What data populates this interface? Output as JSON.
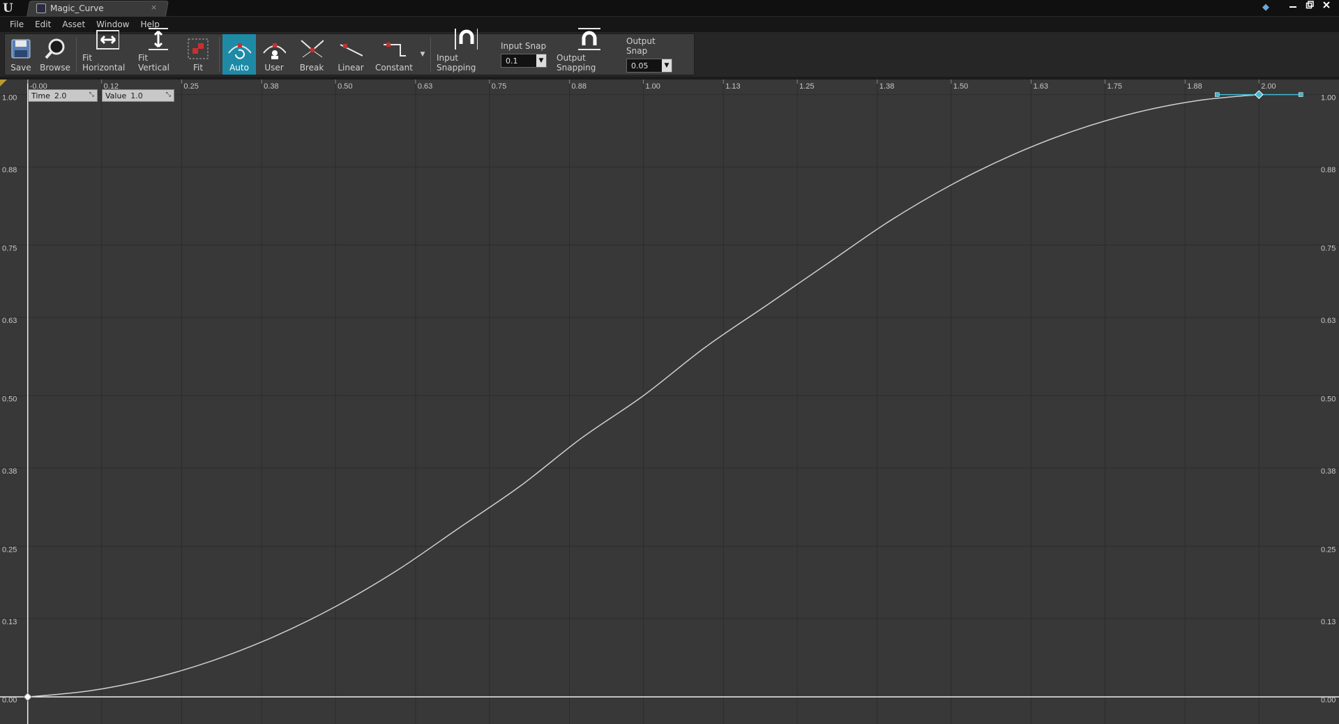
{
  "window": {
    "tab_title": "Magic_Curve",
    "tab_close_glyph": "×",
    "app_icon": "unreal-engine-logo",
    "logo_text": "U",
    "controls": [
      "minimize-icon",
      "restore-icon",
      "close-icon"
    ]
  },
  "menu": {
    "items": [
      "File",
      "Edit",
      "Asset",
      "Window",
      "Help"
    ]
  },
  "toolbar": {
    "save_label": "Save",
    "browse_label": "Browse",
    "fit_horizontal_label": "Fit Horizontal",
    "fit_vertical_label": "Fit Vertical",
    "fit_label": "Fit",
    "auto_label": "Auto",
    "user_label": "User",
    "break_label": "Break",
    "linear_label": "Linear",
    "constant_label": "Constant",
    "input_snapping_label": "Input Snapping",
    "input_snap_label": "Input Snap",
    "input_snap_value": "0.1",
    "output_snapping_label": "Output Snapping",
    "output_snap_label": "Output Snap",
    "output_snap_value": "0.05",
    "active_tangent_mode": "Auto",
    "accent_color": "#1f8aa6"
  },
  "key_info": {
    "time_label": "Time",
    "time_value": "2.0",
    "value_label": "Value",
    "value_value": "1.0"
  },
  "chart_data": {
    "type": "line",
    "title": "",
    "xlabel": "",
    "ylabel": "",
    "x_ticks": [
      "-0.00",
      "0.12",
      "0.25",
      "0.38",
      "0.50",
      "0.63",
      "0.75",
      "0.88",
      "1.00",
      "1.13",
      "1.25",
      "1.38",
      "1.50",
      "1.63",
      "1.75",
      "1.88",
      "2.00"
    ],
    "y_ticks": [
      "1.00",
      "0.88",
      "0.75",
      "0.63",
      "0.50",
      "0.38",
      "0.25",
      "0.13",
      "0.00"
    ],
    "xlim": [
      -0.045,
      2.13
    ],
    "ylim": [
      -0.045,
      1.025
    ],
    "grid": true,
    "series": [
      {
        "color": "#d0d0d0",
        "x": [
          0.0,
          0.1,
          0.2,
          0.3,
          0.4,
          0.5,
          0.6,
          0.7,
          0.8,
          0.9,
          1.0,
          1.1,
          1.2,
          1.3,
          1.4,
          1.5,
          1.6,
          1.7,
          1.8,
          1.9,
          2.0
        ],
        "values": [
          0.0,
          0.01,
          0.03,
          0.06,
          0.1,
          0.15,
          0.21,
          0.28,
          0.35,
          0.43,
          0.5,
          0.58,
          0.65,
          0.72,
          0.79,
          0.85,
          0.9,
          0.94,
          0.97,
          0.99,
          1.0
        ]
      }
    ],
    "keys": [
      {
        "time": 0.0,
        "value": 0.0,
        "selected": false
      },
      {
        "time": 2.0,
        "value": 1.0,
        "selected": true
      }
    ],
    "selected_key_color": "#3fb8d0",
    "cursor_time": 0.0
  }
}
